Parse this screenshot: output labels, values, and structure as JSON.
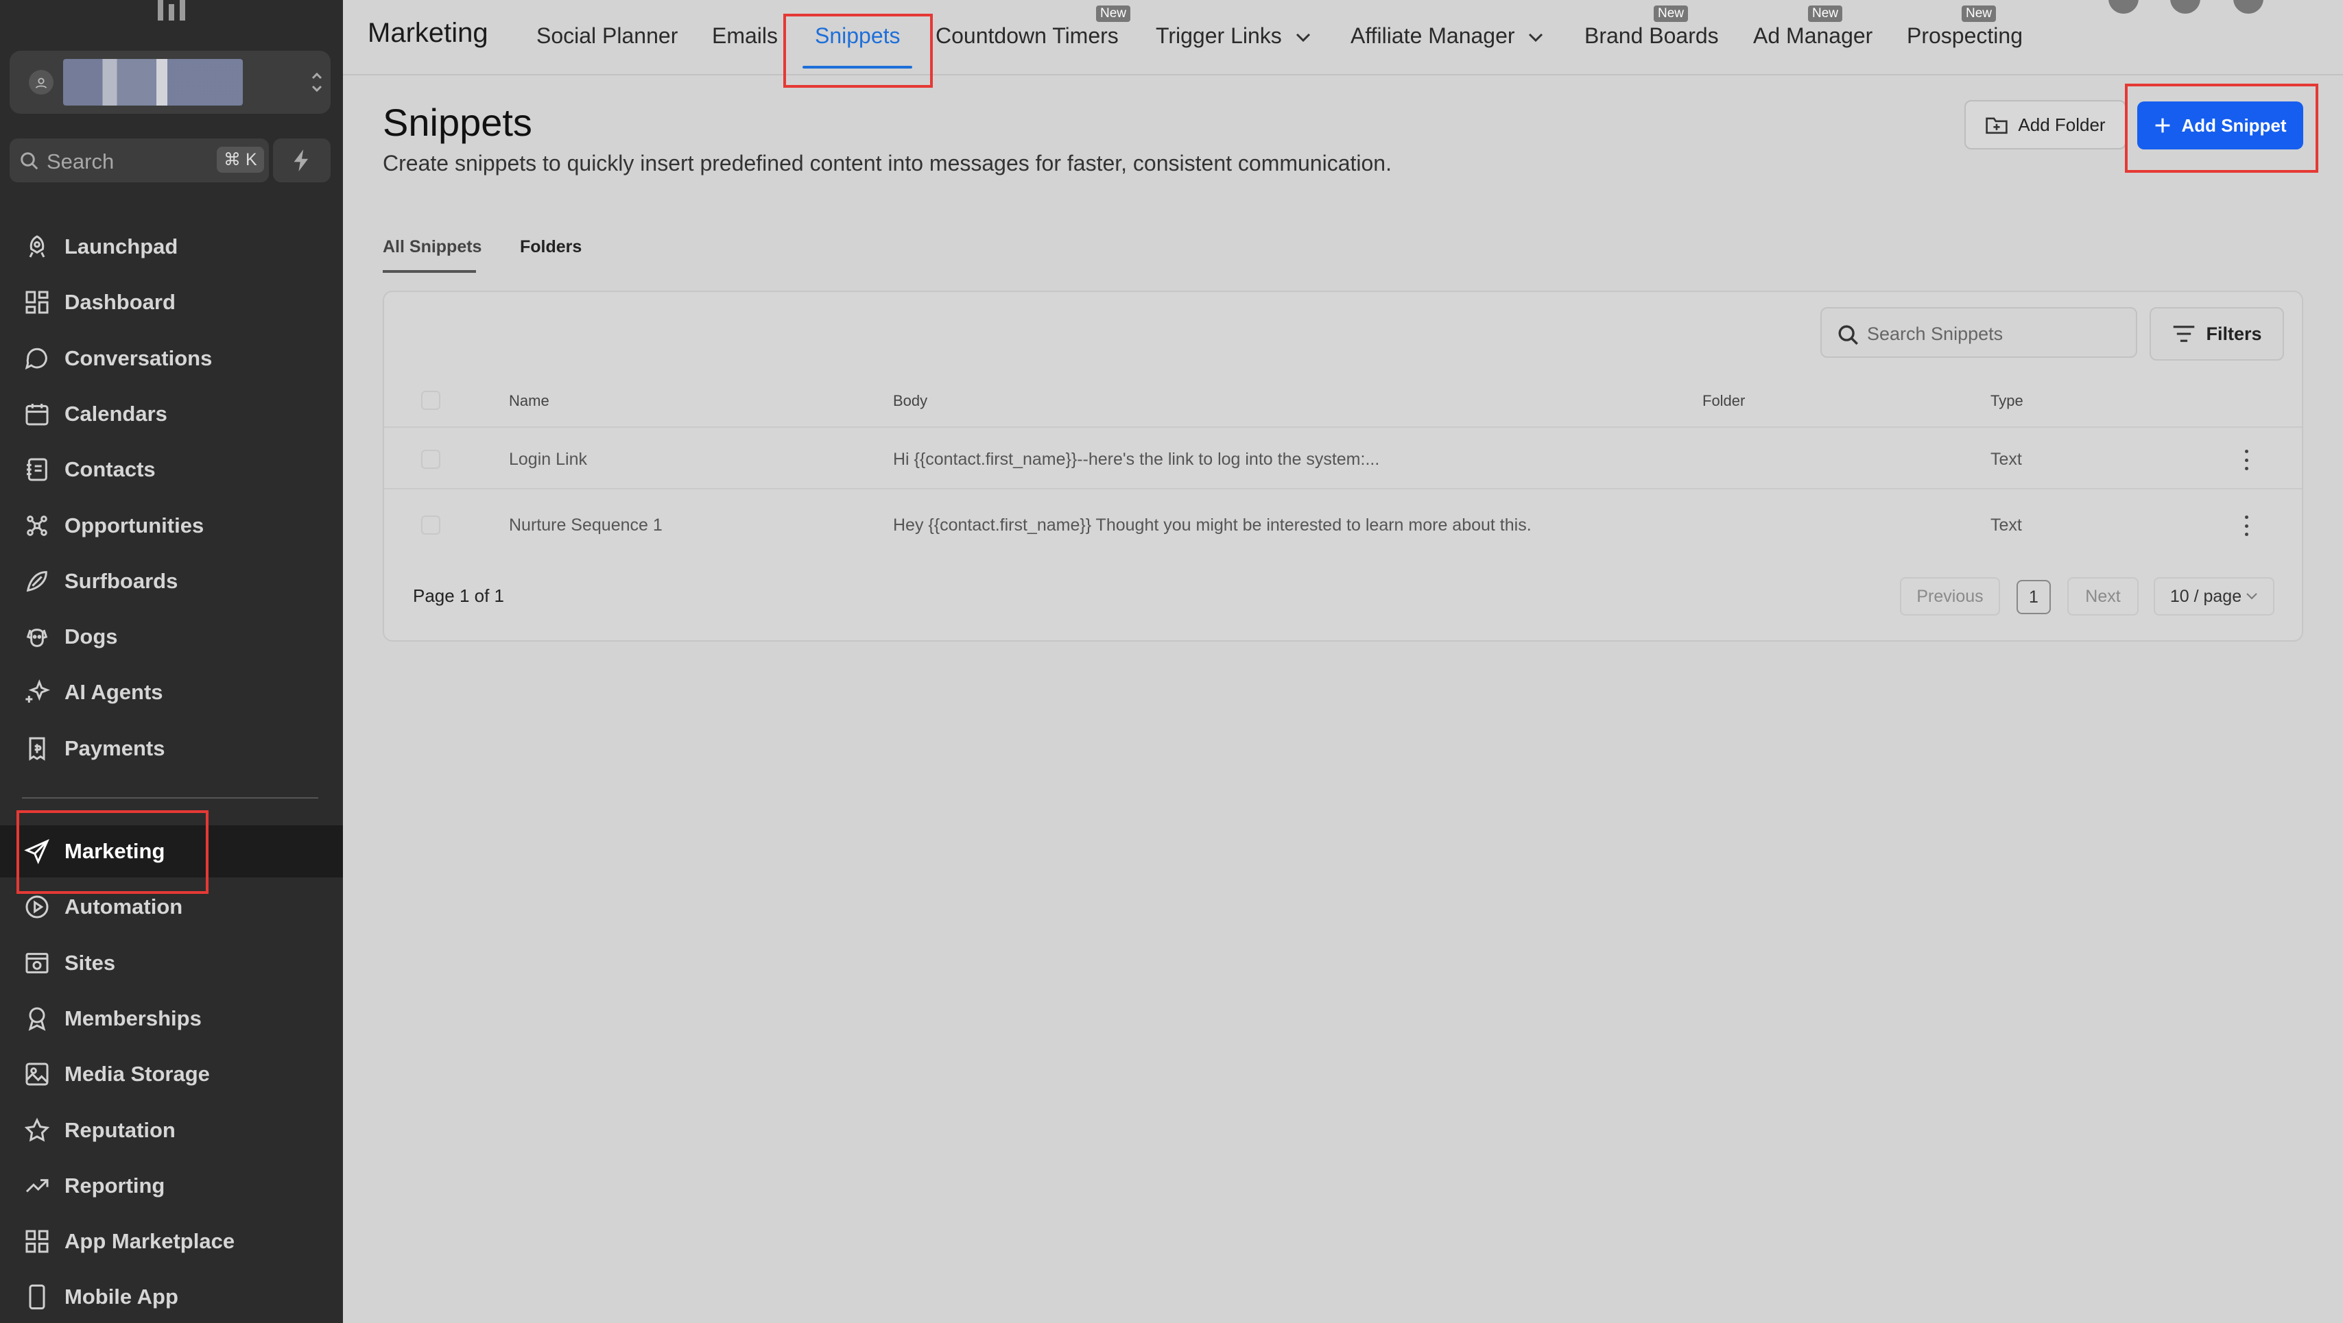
{
  "sidebar": {
    "search_placeholder": "Search",
    "shortcut": "⌘ K",
    "items_top": [
      {
        "label": "Launchpad",
        "icon": "rocket-icon"
      },
      {
        "label": "Dashboard",
        "icon": "dashboard-grid-icon"
      },
      {
        "label": "Conversations",
        "icon": "chat-bubble-icon"
      },
      {
        "label": "Calendars",
        "icon": "calendar-icon"
      },
      {
        "label": "Contacts",
        "icon": "contact-book-icon"
      },
      {
        "label": "Opportunities",
        "icon": "opportunities-icon"
      },
      {
        "label": "Surfboards",
        "icon": "surfboard-icon"
      },
      {
        "label": "Dogs",
        "icon": "dog-icon"
      },
      {
        "label": "AI Agents",
        "icon": "sparkle-icon"
      },
      {
        "label": "Payments",
        "icon": "receipt-icon"
      }
    ],
    "items_bottom": [
      {
        "label": "Marketing",
        "icon": "paper-plane-icon",
        "active": true
      },
      {
        "label": "Automation",
        "icon": "automation-icon"
      },
      {
        "label": "Sites",
        "icon": "globe-window-icon"
      },
      {
        "label": "Memberships",
        "icon": "award-icon"
      },
      {
        "label": "Media Storage",
        "icon": "image-icon"
      },
      {
        "label": "Reputation",
        "icon": "star-icon"
      },
      {
        "label": "Reporting",
        "icon": "trend-line-icon"
      },
      {
        "label": "App Marketplace",
        "icon": "apps-grid-icon"
      },
      {
        "label": "Mobile App",
        "icon": "mobile-icon"
      }
    ]
  },
  "topnav": {
    "title": "Marketing",
    "tabs": [
      {
        "label": "Social Planner"
      },
      {
        "label": "Emails"
      },
      {
        "label": "Snippets",
        "active": true
      },
      {
        "label": "Countdown Timers",
        "badge": "New"
      },
      {
        "label": "Trigger Links",
        "dropdown": true
      },
      {
        "label": "Affiliate Manager",
        "dropdown": true
      },
      {
        "label": "Brand Boards",
        "badge": "New"
      },
      {
        "label": "Ad Manager",
        "badge": "New"
      },
      {
        "label": "Prospecting",
        "badge": "New"
      }
    ]
  },
  "page": {
    "title": "Snippets",
    "subtitle": "Create snippets to quickly insert predefined content into messages for faster, consistent communication.",
    "add_folder_label": "Add Folder",
    "add_snippet_label": "Add Snippet",
    "subtabs": [
      "All Snippets",
      "Folders"
    ]
  },
  "table": {
    "search_placeholder": "Search Snippets",
    "filters_label": "Filters",
    "columns": [
      "Name",
      "Body",
      "Folder",
      "Type"
    ],
    "rows": [
      {
        "name": "Login Link",
        "body": "Hi {{contact.first_name}}--here's the link to log into the system:...",
        "folder": "",
        "type": "Text"
      },
      {
        "name": "Nurture Sequence 1",
        "body": "Hey {{contact.first_name}} Thought you might be interested to learn more about this.",
        "folder": "",
        "type": "Text"
      }
    ],
    "page_info": "Page 1 of 1",
    "prev_label": "Previous",
    "current_page": "1",
    "next_label": "Next",
    "page_size": "10 / page"
  },
  "colors": {
    "accent": "#155eef",
    "active_tab": "#1e6fd9",
    "sidebar_bg": "#2c2c2c",
    "highlight_box": "#e53935"
  }
}
